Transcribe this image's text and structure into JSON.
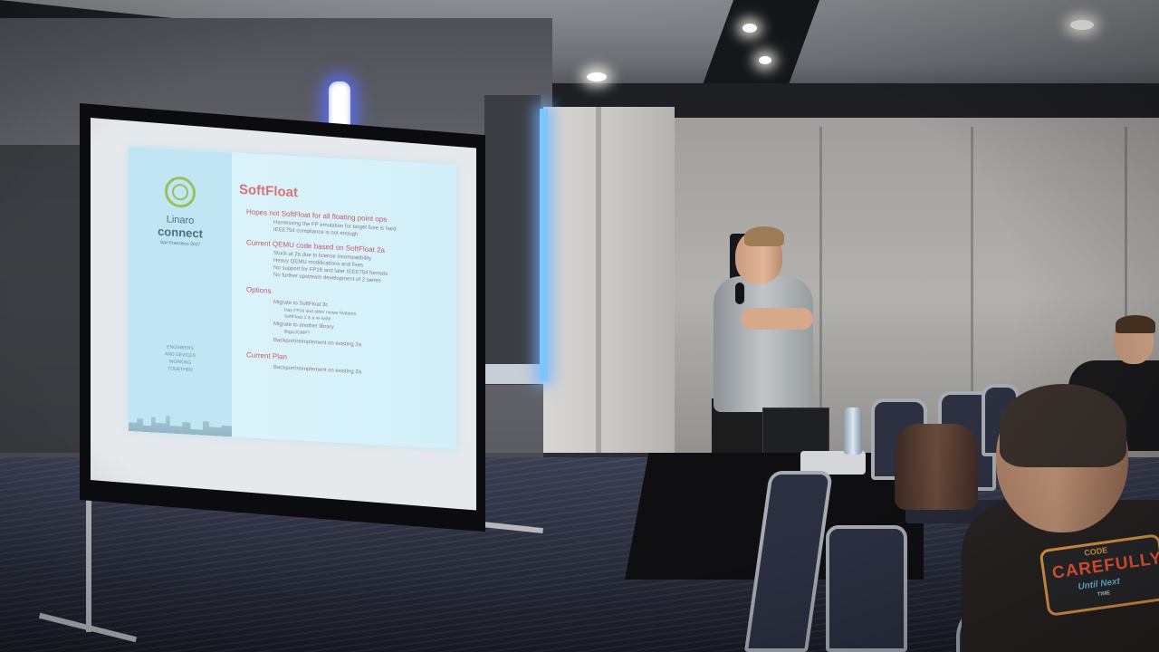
{
  "slide": {
    "logo_line1": "Linaro",
    "logo_line2": "connect",
    "logo_line3": "San Francisco 2017",
    "side_text": [
      "ENGINEERS",
      "AND DEVICES",
      "WORKING",
      "TOGETHER"
    ],
    "title": "SoftFloat",
    "bullets": [
      {
        "text": "Hopes not SoftFloat for all floating point ops",
        "subs": [
          "Harnessing the FP emulation for target fuse is hard",
          "IEEE754 compliance is not enough"
        ]
      },
      {
        "text": "Current QEMU code based on SoftFloat 2a",
        "subs": [
          "Stuck at 2a due to license incompatibility",
          "Heavy QEMU modifications and fixes",
          "No support for FP16 and later IEEE754 formats",
          "No further upstream development of 2 series"
        ]
      },
      {
        "text": "Options",
        "subs": [
          "Migrate to SoftFloat 3c",
          "Migrate to another library",
          "Backport/reimplement on existing 2a"
        ],
        "subsubs": [
          "Has FP16 and other newer features",
          "SoftFloat 3 is a re-write",
          "libgcc/GMP?"
        ]
      },
      {
        "text": "Current Plan",
        "subs": [
          "Backport/reimplement on existing 2a"
        ]
      }
    ]
  },
  "shirt": {
    "line1": "CODE",
    "line2": "CAREFULLY",
    "line3": "Until Next",
    "line4": "TIME"
  },
  "colors": {
    "slide_bg": "#d2f0f9",
    "slide_title": "#d7727a",
    "logo_green": "#9cbf5b",
    "lamp_glow": "#5a6eff",
    "shirt_orange": "#ff5f3a",
    "shirt_blue": "#6fc8ef"
  }
}
